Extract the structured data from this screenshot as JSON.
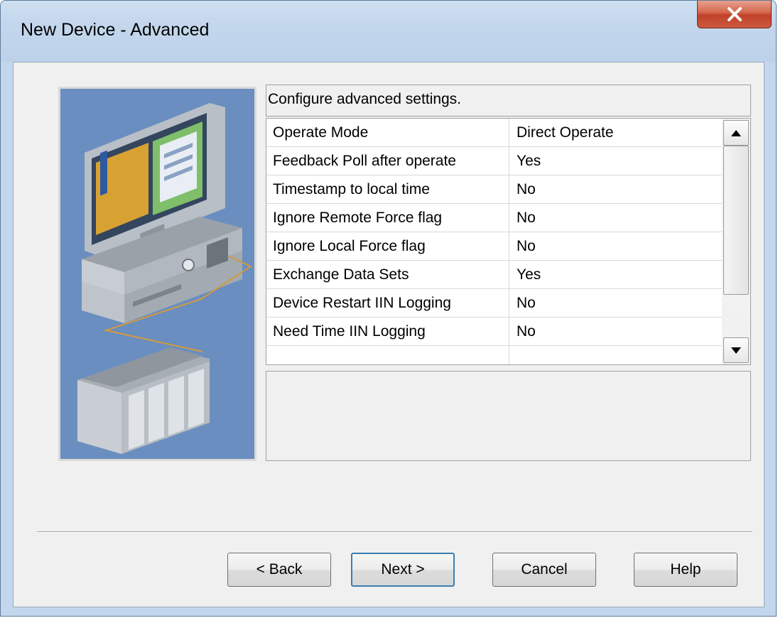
{
  "window": {
    "title": "New Device - Advanced",
    "close_label": "X"
  },
  "description": "Configure advanced settings.",
  "properties": [
    {
      "name": "Operate Mode",
      "value": "Direct Operate"
    },
    {
      "name": "Feedback Poll after operate",
      "value": "Yes"
    },
    {
      "name": "Timestamp to local time",
      "value": "No"
    },
    {
      "name": "Ignore Remote Force flag",
      "value": "No"
    },
    {
      "name": "Ignore Local Force flag",
      "value": "No"
    },
    {
      "name": "Exchange Data Sets",
      "value": "Yes"
    },
    {
      "name": "Device Restart IIN Logging",
      "value": "No"
    },
    {
      "name": "Need Time IIN Logging",
      "value": "No"
    },
    {
      "name": "",
      "value": ""
    }
  ],
  "buttons": {
    "back_label": "< Back",
    "next_label": "Next >",
    "cancel_label": "Cancel",
    "help_label": "Help"
  },
  "icons": {
    "close": "close-icon",
    "scroll_up": "arrow-up-icon",
    "scroll_down": "arrow-down-icon",
    "illustration": "computer-plc-illustration"
  },
  "colors": {
    "illustration_bg": "#6a8ec0",
    "close_button": "#c1412a",
    "default_button_border": "#3c7fb1"
  }
}
